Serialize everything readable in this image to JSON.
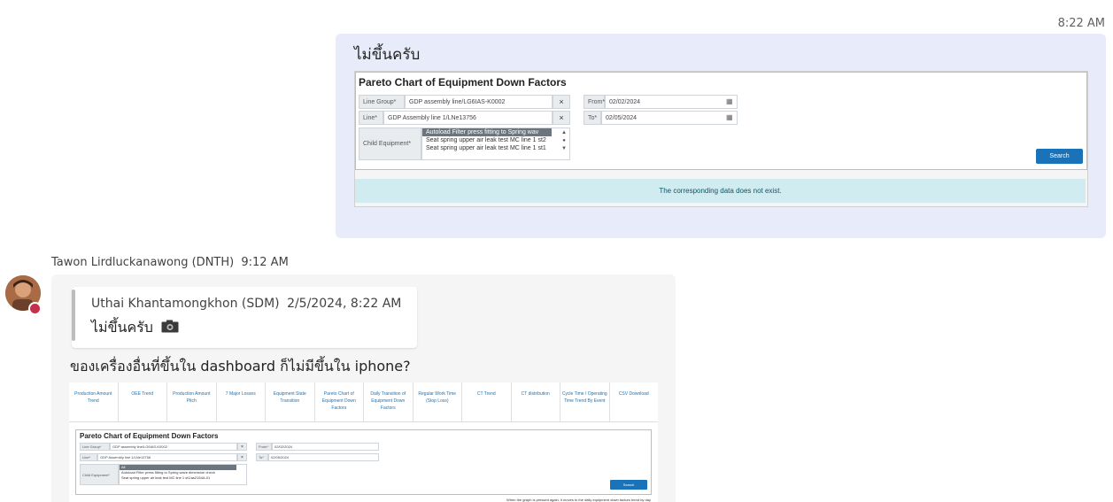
{
  "outgoing": {
    "time": "8:22 AM",
    "text": "ไม่ขึ้นครับ"
  },
  "screenshot1": {
    "title": "Pareto Chart of Equipment Down Factors",
    "line_group_label": "Line Group*",
    "line_group_value": "GDP assembly line/LG6IAS-K0002",
    "line_label": "Line*",
    "line_value": "GDP Assembly line 1/LNe13756",
    "clear_symbol": "×",
    "from_label": "From*",
    "from_value": "02/02/2024",
    "to_label": "To*",
    "to_value": "02/05/2024",
    "child_label": "Child Equipment*",
    "child_options": [
      "Autoload Filter press fitting to Spring wav",
      "Seat spring upper air leak test MC line 1 st2",
      "Seat spring upper air leak test MC line 1 st1"
    ],
    "search_label": "Search",
    "nodata_message": "The corresponding data does not exist."
  },
  "incoming": {
    "sender": "Tawon Lirdluckanawong (DNTH)",
    "time": "9:12 AM",
    "quote": {
      "author": "Uthai Khantamongkhon (SDM)",
      "time": "2/5/2024, 8:22 AM",
      "text": "ไม่ขึ้นครับ",
      "icon": "camera-icon"
    },
    "text": "ของเครื่องอื่นที่ขึ้นใน dashboard ก็ไม่มีขึ้นใน iphone?"
  },
  "screenshot2": {
    "tabs": [
      "Production Amount Trend",
      "OEE Trend",
      "Production Amount Pitch",
      "7 Major Losses",
      "Equipment State Transition",
      "Pareto Chart of Equipment Down Factors",
      "Daily Transition of Equipment Down Factors",
      "Regular Work Time (Stop Loss)",
      "CT Trend",
      "CT distribution",
      "Cycle Time / Operating Time Trend By Event",
      "CSV Download"
    ],
    "title": "Pareto Chart of Equipment Down Factors",
    "line_group_label": "Line Group*",
    "line_group_value": "GDP assembly line/LG6IAS-K0002",
    "line_label": "Line*",
    "line_value": "GDP Assembly line 1/LNe13756",
    "from_label": "From*",
    "from_value": "02/02/2024",
    "to_label": "To*",
    "to_value": "02/05/2024",
    "child_label": "Child Equipment*",
    "child_options": [
      "All",
      "Autoload Filter press fitting to Spring wave dimension check",
      "Seat spring upper air leak test MC line 1 st1/as2154A-01"
    ],
    "search_label": "Search",
    "footer_note": "When the graph is pressed again, it moves to the daily equipment down factors trend by day"
  }
}
